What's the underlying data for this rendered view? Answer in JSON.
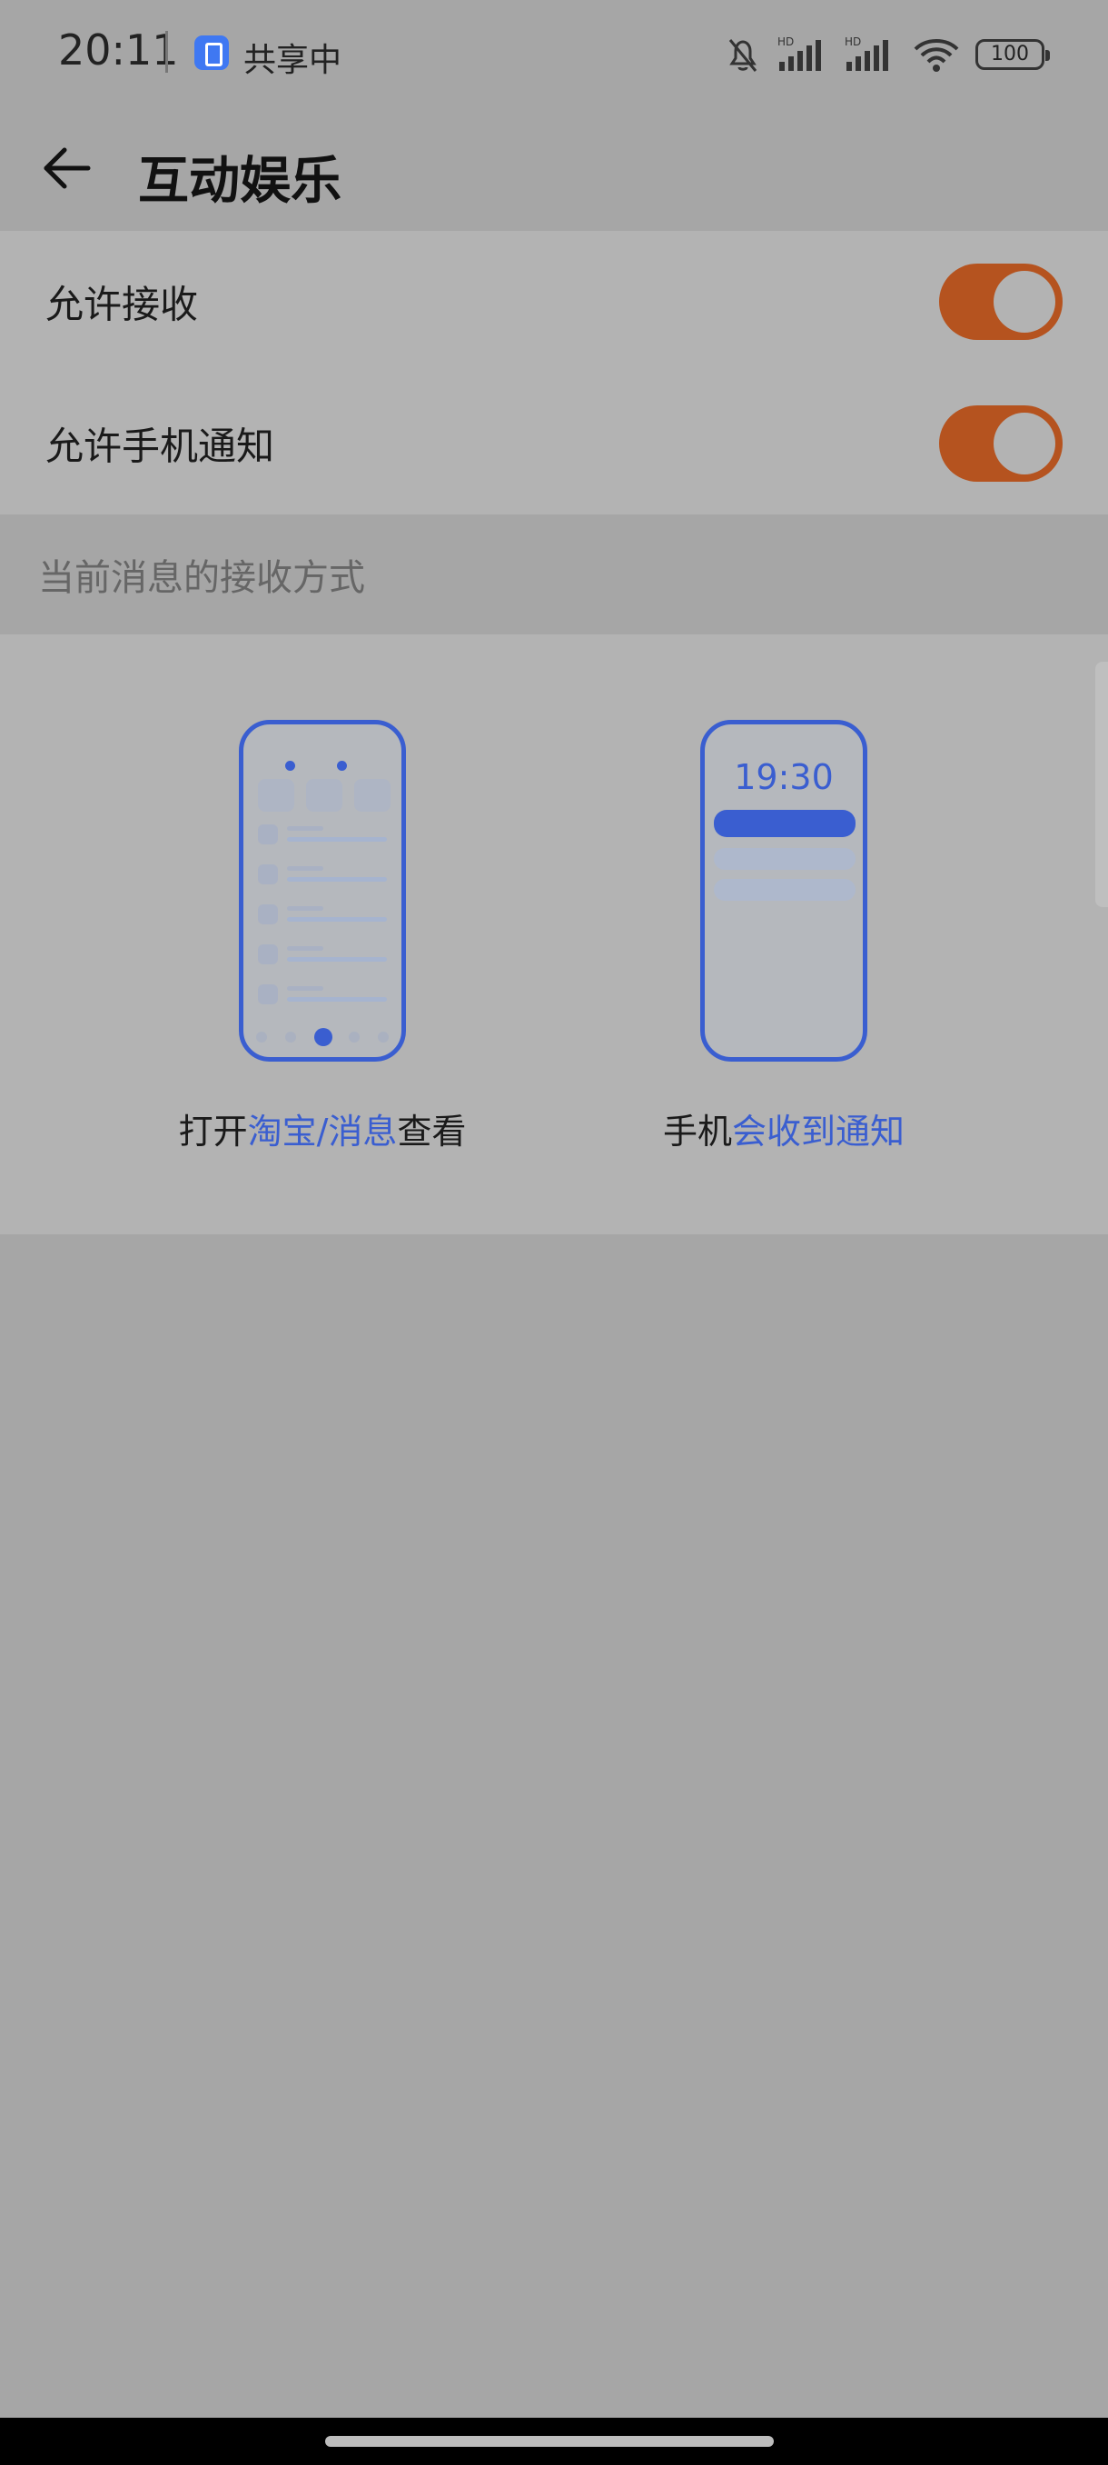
{
  "status_bar": {
    "time": "20:11",
    "share_label": "共享中",
    "network_1": "HD",
    "network_2": "HD",
    "battery": "100"
  },
  "header": {
    "title": "互动娱乐"
  },
  "settings": [
    {
      "label": "允许接收",
      "enabled": true
    },
    {
      "label": "允许手机通知",
      "enabled": true
    }
  ],
  "section": {
    "title": "当前消息的接收方式"
  },
  "modes": [
    {
      "caption_prefix": "打开",
      "caption_highlight": "淘宝/消息",
      "caption_suffix": "查看"
    },
    {
      "caption_prefix": "手机",
      "caption_highlight": "会收到通知",
      "caption_suffix": "",
      "phone_time": "19:30"
    }
  ],
  "colors": {
    "accent_orange": "#b5531f",
    "accent_blue": "#3a5ed0"
  }
}
